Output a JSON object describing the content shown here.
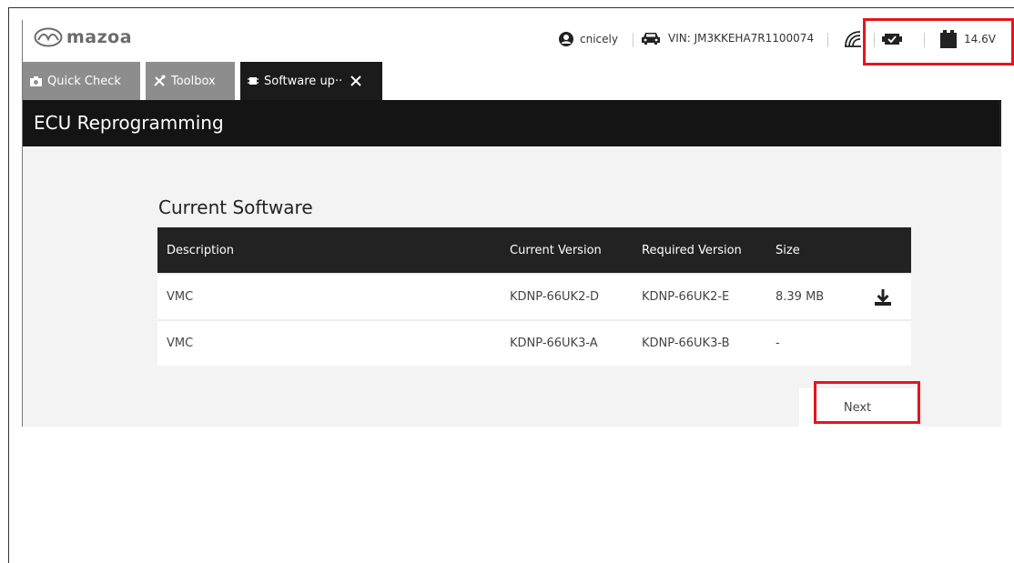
{
  "brand": {
    "logo_text": "mazoa"
  },
  "status_bar": {
    "user": "cnicely",
    "vin": "VIN: JM3KKEHA7R1100074",
    "voltage": "14.6V",
    "icons": [
      "user-icon",
      "car-icon",
      "signal-icon",
      "battery-connector-icon",
      "battery-icon"
    ]
  },
  "tabs": [
    {
      "label": "Quick Check",
      "icon": "camera-icon",
      "active": false
    },
    {
      "label": "Toolbox",
      "icon": "tools-icon",
      "active": false
    },
    {
      "label": "Software up··",
      "icon": "chip-icon",
      "active": true
    }
  ],
  "page": {
    "title": "ECU Reprogramming"
  },
  "current_software": {
    "title": "Current Software",
    "columns": [
      "Description",
      "Current Version",
      "Required Version",
      "Size"
    ],
    "rows": [
      {
        "description": "VMC",
        "current_version": "KDNP-66UK2-D",
        "required_version": "KDNP-66UK2-E",
        "size": "8.39 MB",
        "download": true
      },
      {
        "description": "VMC",
        "current_version": "KDNP-66UK3-A",
        "required_version": "KDNP-66UK3-B",
        "size": "-",
        "download": false
      }
    ]
  },
  "actions": {
    "next_label": "Next"
  },
  "colors": {
    "highlight": "#e8131b",
    "header_bg": "#141414",
    "tab_inactive": "#8d8d8d"
  }
}
